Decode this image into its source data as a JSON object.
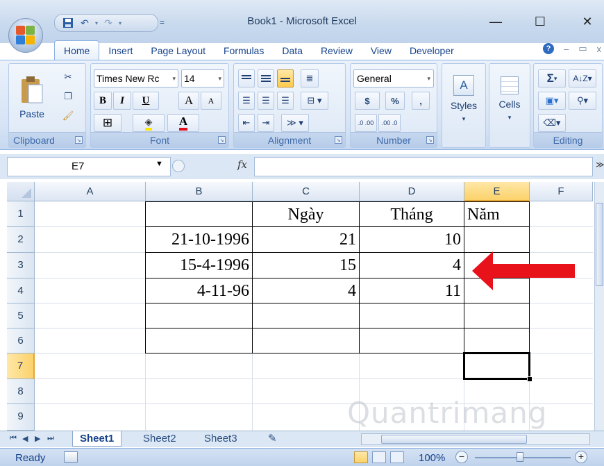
{
  "window": {
    "title": "Book1 - Microsoft Excel"
  },
  "quick_access": {
    "more": "="
  },
  "window_controls": {
    "minimize": "—",
    "maximize": "☐",
    "close": "✕"
  },
  "ribbon_tabs": [
    "Home",
    "Insert",
    "Page Layout",
    "Formulas",
    "Data",
    "Review",
    "View",
    "Developer"
  ],
  "ribbon_right": {
    "help": "?",
    "minimize": "–",
    "restore": "▭",
    "close": "x"
  },
  "clipboard": {
    "paste_label": "Paste",
    "group_label": "Clipboard"
  },
  "font": {
    "name": "Times New Rc",
    "size": "14",
    "bold": "B",
    "italic": "I",
    "underline": "U",
    "grow": "A",
    "shrink": "A",
    "font_color": "A",
    "group_label": "Font"
  },
  "alignment": {
    "group_label": "Alignment"
  },
  "number": {
    "format": "General",
    "currency": "$",
    "percent": "%",
    "comma": ",",
    "inc_decimal": ".0 .00",
    "dec_decimal": ".00 .0",
    "group_label": "Number"
  },
  "styles": {
    "label": "Styles"
  },
  "cells": {
    "label": "Cells"
  },
  "editing": {
    "sum": "Σ",
    "group_label": "Editing"
  },
  "formula_bar": {
    "name_box": "E7",
    "fx": "fx",
    "value": ""
  },
  "columns": [
    {
      "label": "A",
      "selected": false
    },
    {
      "label": "B",
      "selected": false
    },
    {
      "label": "C",
      "selected": false
    },
    {
      "label": "D",
      "selected": false
    },
    {
      "label": "E",
      "selected": true
    },
    {
      "label": "F",
      "selected": false
    }
  ],
  "rows": [
    {
      "label": "1",
      "selected": false
    },
    {
      "label": "2",
      "selected": false
    },
    {
      "label": "3",
      "selected": false
    },
    {
      "label": "4",
      "selected": false
    },
    {
      "label": "5",
      "selected": false
    },
    {
      "label": "6",
      "selected": false
    },
    {
      "label": "7",
      "selected": true
    },
    {
      "label": "8",
      "selected": false
    },
    {
      "label": "9",
      "selected": false
    }
  ],
  "cells_data": {
    "C1": "Ngày",
    "D1": "Tháng",
    "E1": "Năm",
    "B2": "21-10-1996",
    "C2": "21",
    "D2": "10",
    "B3": "15-4-1996",
    "C3": "15",
    "D3": "4",
    "B4": "4-11-96",
    "C4": "4",
    "D4": "11"
  },
  "active_cell": "E7",
  "sheets": [
    {
      "label": "Sheet1",
      "active": true
    },
    {
      "label": "Sheet2",
      "active": false
    },
    {
      "label": "Sheet3",
      "active": false
    }
  ],
  "sheet_nav": [
    "⏮",
    "◀",
    "▶",
    "⏭"
  ],
  "status": {
    "text": "Ready",
    "zoom": "100%",
    "zoom_out": "−",
    "zoom_in": "+"
  },
  "watermark": "Quantrimang",
  "colors": {
    "arrow": "#e8121b",
    "selection": "#fbd26b"
  }
}
